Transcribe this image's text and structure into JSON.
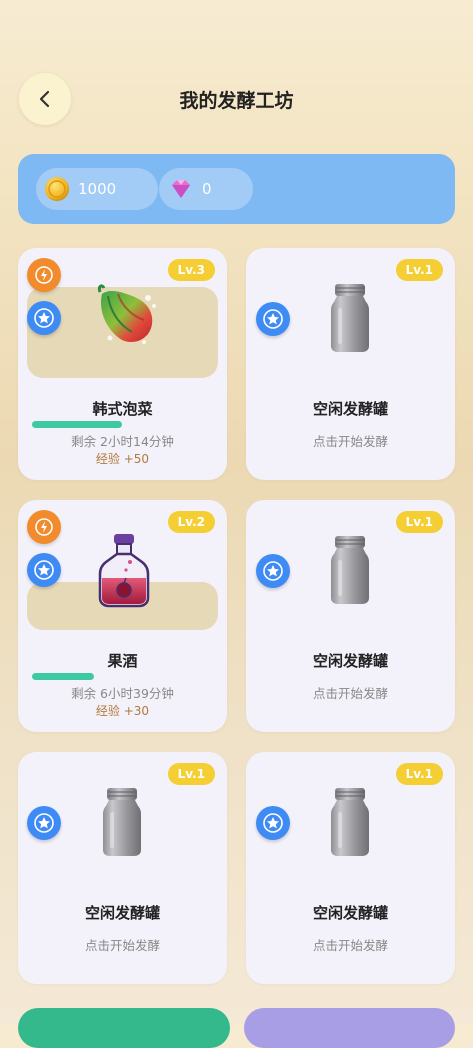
{
  "header": {
    "title": "我的发酵工坊",
    "back_icon": "chevron-left-icon"
  },
  "currency": {
    "coins": "1000",
    "gems": "0"
  },
  "slots": [
    {
      "level": "Lv.3",
      "name": "韩式泡菜",
      "status": "剩余 2小时14分钟",
      "exp": "经验 +50",
      "state": "fermenting",
      "progress": 0.47,
      "item_icon": "kimchi-icon"
    },
    {
      "level": "Lv.1",
      "name": "空闲发酵罐",
      "status": "点击开始发酵",
      "state": "idle",
      "item_icon": "empty-jar-icon"
    },
    {
      "level": "Lv.2",
      "name": "果酒",
      "status": "剩余 6小时39分钟",
      "exp": "经验 +30",
      "state": "fermenting",
      "progress": 0.32,
      "item_icon": "fruit-wine-icon"
    },
    {
      "level": "Lv.1",
      "name": "空闲发酵罐",
      "status": "点击开始发酵",
      "state": "idle",
      "item_icon": "empty-jar-icon"
    },
    {
      "level": "Lv.1",
      "name": "空闲发酵罐",
      "status": "点击开始发酵",
      "state": "idle",
      "item_icon": "empty-jar-icon"
    },
    {
      "level": "Lv.1",
      "name": "空闲发酵罐",
      "status": "点击开始发酵",
      "state": "idle",
      "item_icon": "empty-jar-icon"
    }
  ],
  "colors": {
    "accent_blue": "#7eb9f3",
    "level_badge": "#f5ce34",
    "progress": "#3ecaa1",
    "bolt_badge": "#f28b2c",
    "star_badge": "#3f8bf5"
  }
}
